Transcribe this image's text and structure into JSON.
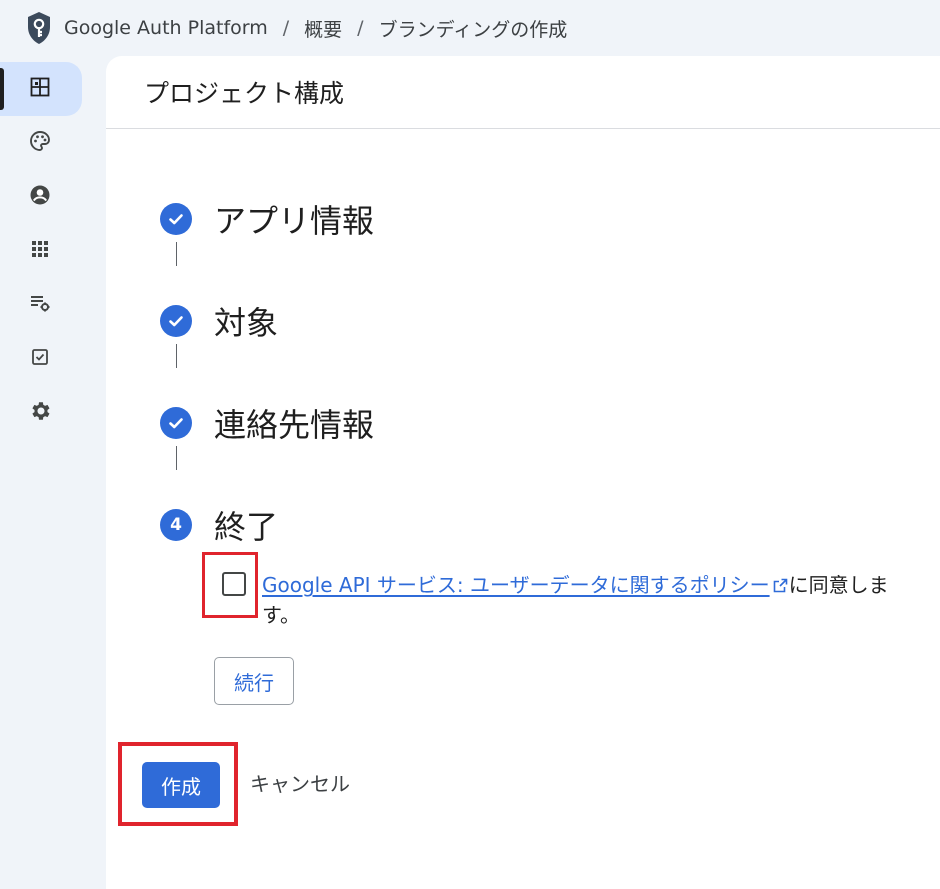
{
  "breadcrumb": {
    "items": [
      "Google Auth Platform",
      "概要",
      "ブランディングの作成"
    ],
    "separator": "/"
  },
  "sidebar": {
    "items": [
      {
        "icon": "dashboard-icon",
        "active": true
      },
      {
        "icon": "palette-icon",
        "active": false
      },
      {
        "icon": "account-circle-icon",
        "active": false
      },
      {
        "icon": "apps-grid-icon",
        "active": false
      },
      {
        "icon": "list-settings-icon",
        "active": false
      },
      {
        "icon": "check-box-icon",
        "active": false
      },
      {
        "icon": "gear-icon",
        "active": false
      }
    ]
  },
  "page": {
    "title": "プロジェクト構成"
  },
  "stepper": {
    "steps": [
      {
        "label": "アプリ情報",
        "status": "complete"
      },
      {
        "label": "対象",
        "status": "complete"
      },
      {
        "label": "連絡先情報",
        "status": "complete"
      },
      {
        "label": "終了",
        "status": "current",
        "number": "4"
      }
    ]
  },
  "consent": {
    "checked": false,
    "link_text": "Google API サービス: ユーザーデータに関するポリシー",
    "suffix": "に同意します。"
  },
  "actions": {
    "continue_label": "続行",
    "create_label": "作成",
    "cancel_label": "キャンセル"
  },
  "colors": {
    "accent": "#2f6bd8",
    "highlight": "#e0242d",
    "rail_active": "#d3e3fd",
    "background": "#f0f4f9"
  }
}
